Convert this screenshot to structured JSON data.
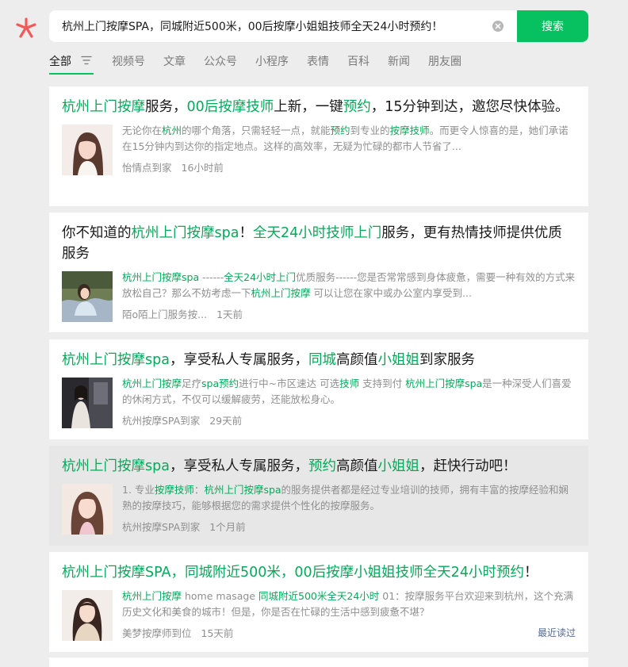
{
  "search": {
    "query": "杭州上门按摩SPA，同城附近500米，00后按摩小姐姐技师全天24小时预约！",
    "button_label": "搜索"
  },
  "tabs": [
    {
      "label": "全部",
      "active": true
    },
    {
      "label": "视频号"
    },
    {
      "label": "文章"
    },
    {
      "label": "公众号"
    },
    {
      "label": "小程序"
    },
    {
      "label": "表情"
    },
    {
      "label": "百科"
    },
    {
      "label": "新闻"
    },
    {
      "label": "朋友圈"
    }
  ],
  "results": [
    {
      "title": [
        {
          "t": "杭州上门按摩",
          "h": true
        },
        {
          "t": "服务，",
          "h": false
        },
        {
          "t": "00后按摩技师",
          "h": true
        },
        {
          "t": "上新，一键",
          "h": false
        },
        {
          "t": "预约",
          "h": true
        },
        {
          "t": "，15分钟到达，邀您尽快体验。",
          "h": false
        }
      ],
      "desc": [
        {
          "t": "无论你在",
          "h": false
        },
        {
          "t": "杭州",
          "h": true
        },
        {
          "t": "的哪个角落，只需轻轻一点，就能",
          "h": false
        },
        {
          "t": "预约",
          "h": true
        },
        {
          "t": "到专业的",
          "h": false
        },
        {
          "t": "按摩技师",
          "h": true
        },
        {
          "t": "。而更令人惊喜的是，她们承诺在15分钟内到达你的指定地点。这样的高效率，无疑为忙碌的都市人节省了...",
          "h": false
        }
      ],
      "source": "怡情点到家",
      "time": "16小时前"
    },
    {
      "title": [
        {
          "t": "你不知道的",
          "h": false
        },
        {
          "t": "杭州上门按摩spa",
          "h": true
        },
        {
          "t": "！",
          "h": false
        },
        {
          "t": "全天24小时技师上门",
          "h": true
        },
        {
          "t": "服务，更有热情技师提供优质服务",
          "h": false
        }
      ],
      "desc": [
        {
          "t": "杭州上门按摩spa",
          "h": true
        },
        {
          "t": " ------",
          "h": false
        },
        {
          "t": "全天24小时上门",
          "h": true
        },
        {
          "t": "优质服务------您是否常常感到身体疲惫，需要一种有效的方式来放松自己？那么不妨考虑一下",
          "h": false
        },
        {
          "t": "杭州上门按摩",
          "h": true
        },
        {
          "t": " 可以让您在家中或办公室内享受到...",
          "h": false
        }
      ],
      "source": "陌o陌上门服务按...",
      "time": "1天前"
    },
    {
      "title": [
        {
          "t": "杭州上门按摩spa",
          "h": true
        },
        {
          "t": "，享受私人专属服务，",
          "h": false
        },
        {
          "t": "同城",
          "h": true
        },
        {
          "t": "高颜值",
          "h": false
        },
        {
          "t": "小姐姐",
          "h": true
        },
        {
          "t": "到家服务",
          "h": false
        }
      ],
      "desc": [
        {
          "t": "杭州上门按摩",
          "h": true
        },
        {
          "t": "足疗",
          "h": false
        },
        {
          "t": "spa预约",
          "h": true
        },
        {
          "t": "进行中~市区速达 可选",
          "h": false
        },
        {
          "t": "技师",
          "h": true
        },
        {
          "t": " 支持到付 ",
          "h": false
        },
        {
          "t": "杭州上门按摩spa",
          "h": true
        },
        {
          "t": "是一种深受人们喜爱的休闲方式，不仅可以缓解疲劳，还能放松身心。",
          "h": false
        }
      ],
      "source": "杭州按摩SPA到家",
      "time": "29天前"
    },
    {
      "title": [
        {
          "t": "杭州上门按摩spa",
          "h": true
        },
        {
          "t": "，享受私人专属服务，",
          "h": false
        },
        {
          "t": "预约",
          "h": true
        },
        {
          "t": "高颜值",
          "h": false
        },
        {
          "t": "小姐姐",
          "h": true
        },
        {
          "t": "，赶快行动吧！",
          "h": false
        }
      ],
      "desc": [
        {
          "t": "1. 专业",
          "h": false
        },
        {
          "t": "按摩技师",
          "h": true
        },
        {
          "t": "：",
          "h": false
        },
        {
          "t": "杭州上门按摩spa",
          "h": true
        },
        {
          "t": "的服务提供者都是经过专业培训的技师，拥有丰富的按摩经验和娴熟的按摩技巧，能够根据您的需求提供个性化的按摩服务。",
          "h": false
        }
      ],
      "source": "杭州按摩SPA到家",
      "time": "1个月前"
    },
    {
      "title": [
        {
          "t": "杭州上门按摩SPA，同城附近500米，00后按摩小姐姐技师全天24小时预约",
          "h": true
        },
        {
          "t": "！",
          "h": false
        }
      ],
      "desc": [
        {
          "t": "杭州上门按摩",
          "h": true
        },
        {
          "t": " home masage ",
          "h": false
        },
        {
          "t": "同城附近500米全天24小时",
          "h": true
        },
        {
          "t": " 01：按摩服务平台欢迎来到杭州，这个充满历史文化和美食的城市！但是，你是否在忙碌的生活中感到疲惫不堪？",
          "h": false
        }
      ],
      "source": "美梦按摩师到位",
      "time": "15天前",
      "badge": "最近读过"
    }
  ]
}
